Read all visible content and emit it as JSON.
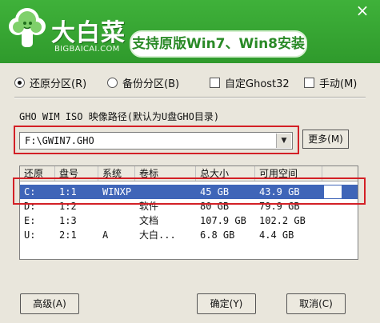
{
  "header": {
    "brand": "大白菜",
    "brand_url": "BIGBAICAI.COM",
    "tagline": "支持原版Win7、Win8安装",
    "close_label": "×",
    "green": "#34a631"
  },
  "options": {
    "restore_label": "还原分区(R)",
    "backup_label": "备份分区(B)",
    "custom_ghost_label": "自定Ghost32",
    "manual_label": "手动(M)",
    "selected": "restore"
  },
  "path": {
    "label": "GHO WIM ISO 映像路径(默认为U盘GHO目录)",
    "value": "F:\\GWIN7.GHO",
    "more_button": "更多(M)"
  },
  "table": {
    "columns": [
      "还原",
      "盘号",
      "系统",
      "卷标",
      "总大小",
      "可用空间"
    ],
    "rows": [
      [
        "C:",
        "1:1",
        "WINXP",
        "",
        "45 GB",
        "43.9 GB"
      ],
      [
        "D:",
        "1:2",
        "",
        "软件",
        "80 GB",
        "79.9 GB"
      ],
      [
        "E:",
        "1:3",
        "",
        "文档",
        "107.9 GB",
        "102.2 GB"
      ],
      [
        "U:",
        "2:1",
        "A",
        "大白...",
        "6.8 GB",
        "4.4 GB"
      ]
    ],
    "selected_row": 0,
    "selection_color": "#3f65b8"
  },
  "footer": {
    "advanced": "高级(A)",
    "ok": "确定(Y)",
    "cancel": "取消(C)"
  },
  "annotation_color": "#d32026"
}
